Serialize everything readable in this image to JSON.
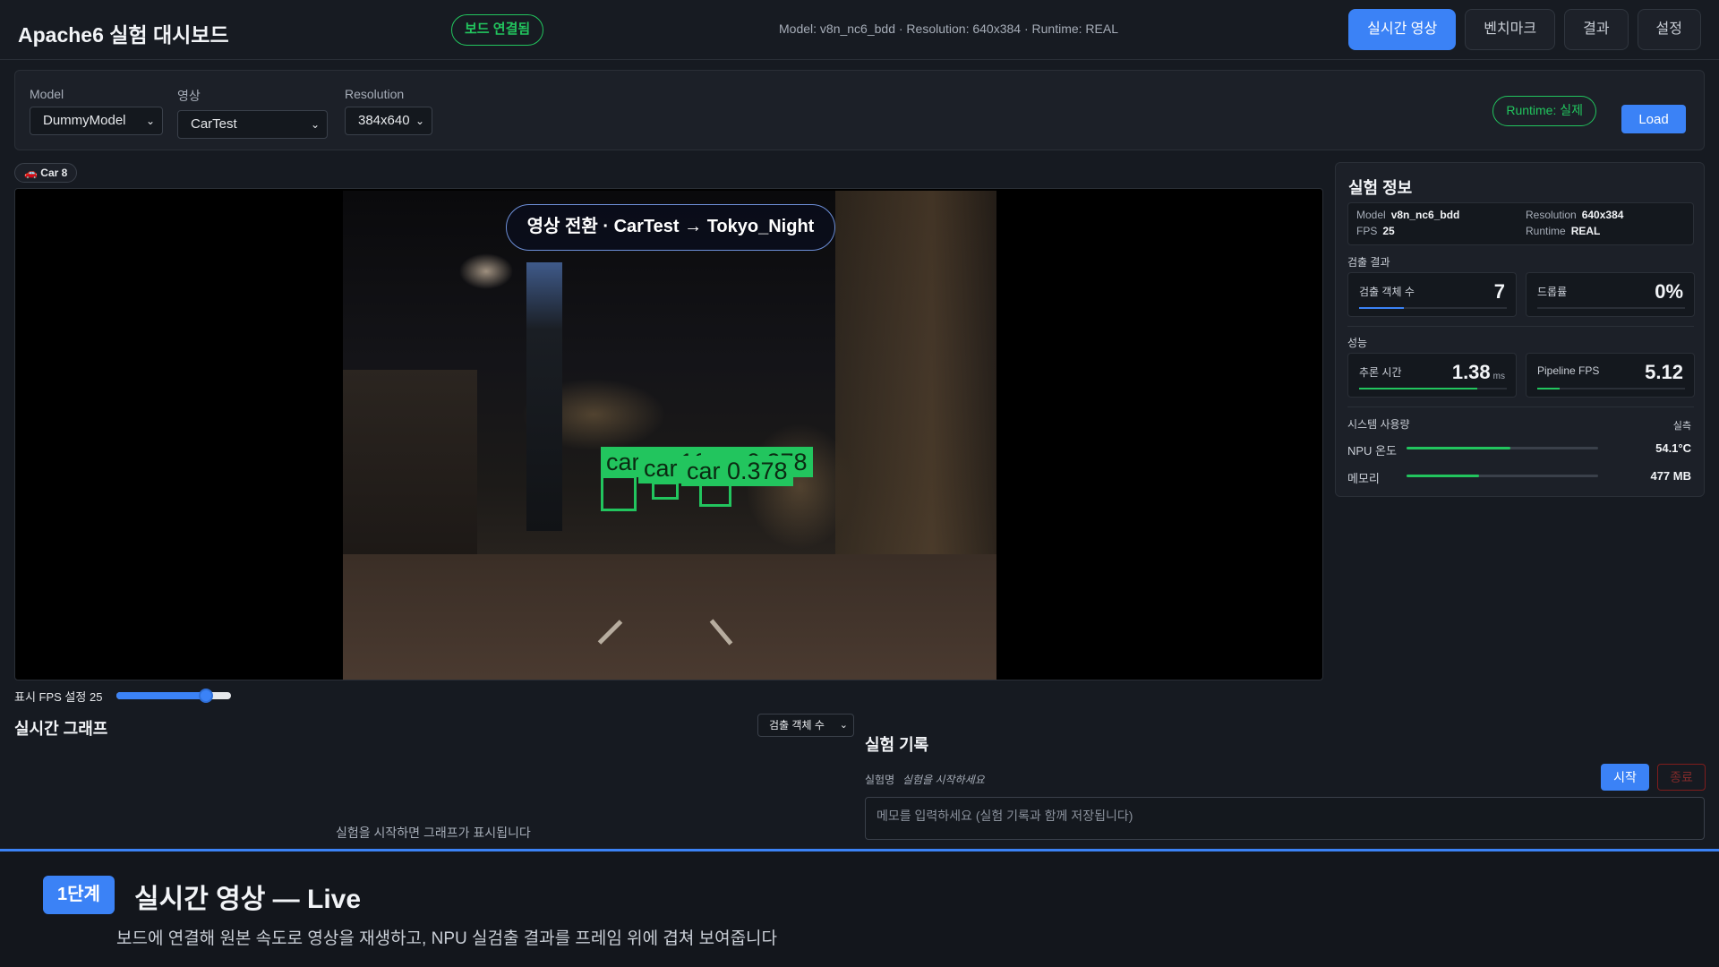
{
  "header": {
    "title": "Apache6 실험 대시보드",
    "connection_badge": "보드 연결됨",
    "info": "Model: v8n_nc6_bdd · Resolution: 640x384 · Runtime: REAL",
    "tabs": [
      {
        "label": "실시간 영상",
        "active": true
      },
      {
        "label": "벤치마크",
        "active": false
      },
      {
        "label": "결과",
        "active": false
      },
      {
        "label": "설정",
        "active": false
      }
    ]
  },
  "controls": {
    "model_label": "Model",
    "model_value": "DummyModel",
    "video_label": "영상",
    "video_value": "CarTest",
    "resolution_label": "Resolution",
    "resolution_value": "384x640",
    "runtime_pill": "Runtime: 실제",
    "load_label": "Load"
  },
  "video": {
    "car_badge": "🚗 Car 8",
    "overlay_title": "영상 전환 · CarTest → Tokyo_Night",
    "detections": [
      {
        "label": "car 0.316"
      },
      {
        "label": "car 0.378"
      },
      {
        "label": "car"
      },
      {
        "label": "car 0.378"
      }
    ]
  },
  "fps": {
    "label": "표시 FPS 설정 25",
    "value": 25,
    "fraction": 0.78
  },
  "graph": {
    "title": "실시간 그래프",
    "metric_select": "검출 객체 수",
    "empty_message": "실험을 시작하면 그래프가 표시됩니다"
  },
  "log": {
    "title": "실험 기록",
    "name_label": "실험명",
    "name_value": "실험을  시작하세요",
    "start_label": "시작",
    "end_label": "종료",
    "memo_placeholder": "메모를 입력하세요 (실험 기록과 함께 저장됩니다)"
  },
  "side": {
    "title": "실험 정보",
    "info": {
      "model_k": "Model",
      "model_v": "v8n_nc6_bdd",
      "resolution_k": "Resolution",
      "resolution_v": "640x384",
      "fps_k": "FPS",
      "fps_v": "25",
      "runtime_k": "Runtime",
      "runtime_v": "REAL"
    },
    "detect_section": "검출 결과",
    "objects_label": "검출 객체 수",
    "objects_value": "7",
    "objects_fraction": 0.3,
    "drop_label": "드롭률",
    "drop_value": "0%",
    "perf_section": "성능",
    "infer_label": "추론 시간",
    "infer_value": "1.38",
    "infer_unit": "ms",
    "infer_fraction": 0.8,
    "pipeline_label": "Pipeline FPS",
    "pipeline_value": "5.12",
    "pipeline_fraction": 0.15,
    "system_section": "시스템 사용량",
    "system_right": "실측",
    "npu_label": "NPU 온도",
    "npu_value": "54.1°C",
    "npu_fraction": 0.54,
    "mem_label": "메모리",
    "mem_value": "477 MB",
    "mem_fraction": 0.38
  },
  "banner": {
    "step": "1단계",
    "title": "실시간 영상 — Live",
    "subtitle": "보드에 연결해 원본 속도로 영상을 재생하고, NPU 실검출 결과를 프레임 위에 겹쳐 보여줍니다"
  },
  "colors": {
    "accent": "#3b82f6",
    "success": "#22c55e",
    "background": "#161a21"
  }
}
